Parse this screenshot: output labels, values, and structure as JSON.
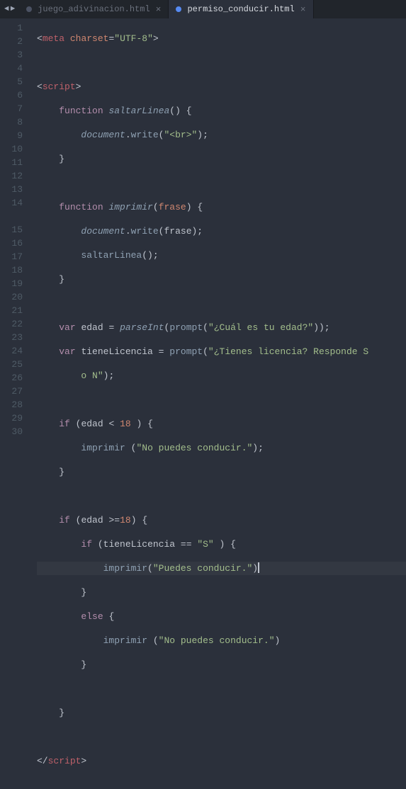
{
  "nav": {
    "back": "◄",
    "fwd": "►"
  },
  "tabs": [
    {
      "label": "juego_adivinacion.html",
      "active": false
    },
    {
      "label": "permiso_conducir.html",
      "active": true
    }
  ],
  "lines": [
    "1",
    "2",
    "3",
    "4",
    "5",
    "6",
    "7",
    "8",
    "9",
    "10",
    "11",
    "12",
    "13",
    "14",
    "",
    "15",
    "16",
    "17",
    "18",
    "19",
    "20",
    "21",
    "22",
    "23",
    "24",
    "25",
    "26",
    "27",
    "28",
    "29",
    "30"
  ],
  "code": {
    "l1_tag_meta": "meta",
    "l1_attr_charset": "charset",
    "l1_val_utf8": "\"UTF-8\"",
    "l3_tag_script": "script",
    "l4_kw_function": "function",
    "l4_fn_saltarLinea": "saltarLinea",
    "l5_obj_document": "document",
    "l5_fn_write": "write",
    "l5_str_br": "\"<br>\"",
    "l8_kw_function": "function",
    "l8_fn_imprimir": "imprimir",
    "l8_param_frase": "frase",
    "l9_obj_document": "document",
    "l9_fn_write": "write",
    "l9_arg_frase": "frase",
    "l10_fn_saltarLinea": "saltarLinea",
    "l13_kw_var": "var",
    "l13_id_edad": "edad",
    "l13_fn_parseInt": "parseInt",
    "l13_fn_prompt": "prompt",
    "l13_str": "\"¿Cuál es tu edad?\"",
    "l14_kw_var": "var",
    "l14_id_lic": "tieneLicencia",
    "l14_fn_prompt": "prompt",
    "l14_str_a": "\"¿Tienes licencia? Responde S",
    "l14_str_b": "o N\"",
    "l16_kw_if": "if",
    "l16_id_edad": "edad",
    "l16_num": "18",
    "l17_fn_imprimir": "imprimir",
    "l17_str": "\"No puedes conducir.\"",
    "l20_kw_if": "if",
    "l20_id_edad": "edad",
    "l20_num": "18",
    "l21_kw_if": "if",
    "l21_id_lic": "tieneLicencia",
    "l21_str": "\"S\"",
    "l22_fn_imprimir": "imprimir",
    "l22_str": "\"Puedes conducir.\"",
    "l24_kw_else": "else",
    "l25_fn_imprimir": "imprimir",
    "l25_str": "\"No puedes conducir.\"",
    "l30_tag_script": "script"
  }
}
